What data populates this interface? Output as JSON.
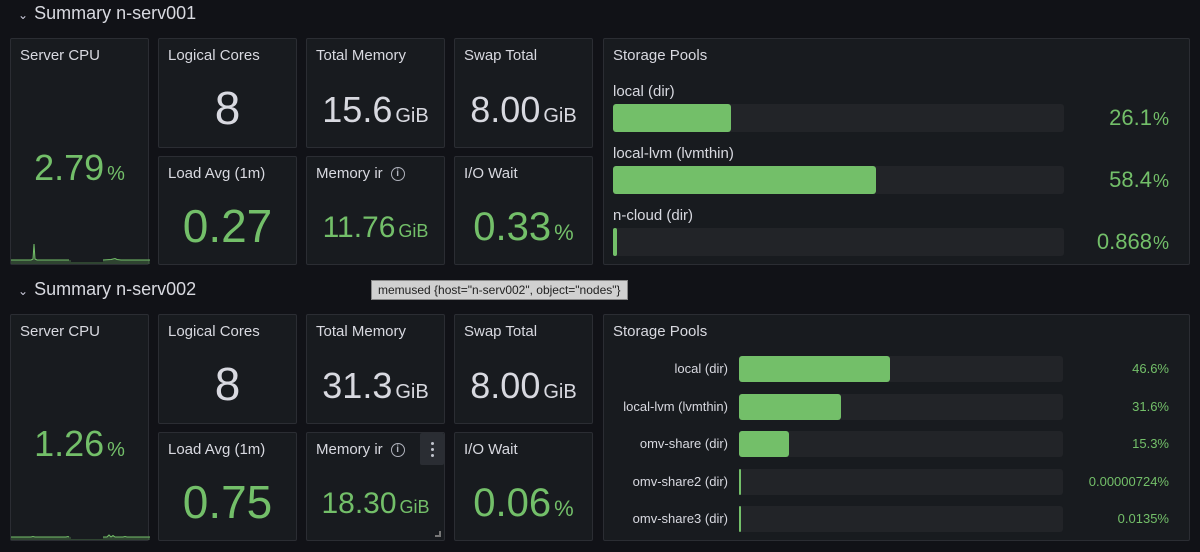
{
  "rows": [
    {
      "title": "Summary n-serv001",
      "server_cpu": {
        "title": "Server CPU",
        "value": "2.79",
        "unit": "%"
      },
      "logical_cores": {
        "title": "Logical Cores",
        "value": "8"
      },
      "total_memory": {
        "title": "Total Memory",
        "value": "15.6",
        "unit": "GiB"
      },
      "swap_total": {
        "title": "Swap Total",
        "value": "8.00",
        "unit": "GiB"
      },
      "load_avg": {
        "title": "Load Avg (1m)",
        "value": "0.27"
      },
      "memory_in_use": {
        "title": "Memory ir",
        "value": "11.76",
        "unit": "GiB"
      },
      "io_wait": {
        "title": "I/O Wait",
        "value": "0.33",
        "unit": "%"
      },
      "storage_pools": {
        "title": "Storage Pools",
        "items": [
          {
            "name": "local (dir)",
            "value": "26.1",
            "unit": "%",
            "percent": 26.1
          },
          {
            "name": "local-lvm (lvmthin)",
            "value": "58.4",
            "unit": "%",
            "percent": 58.4
          },
          {
            "name": "n-cloud (dir)",
            "value": "0.868",
            "unit": "%",
            "percent": 0.868
          }
        ]
      }
    },
    {
      "title": "Summary n-serv002",
      "server_cpu": {
        "title": "Server CPU",
        "value": "1.26",
        "unit": "%"
      },
      "logical_cores": {
        "title": "Logical Cores",
        "value": "8"
      },
      "total_memory": {
        "title": "Total Memory",
        "value": "31.3",
        "unit": "GiB"
      },
      "swap_total": {
        "title": "Swap Total",
        "value": "8.00",
        "unit": "GiB"
      },
      "load_avg": {
        "title": "Load Avg (1m)",
        "value": "0.75"
      },
      "memory_in_use": {
        "title": "Memory ir",
        "value": "18.30",
        "unit": "GiB"
      },
      "io_wait": {
        "title": "I/O Wait",
        "value": "0.06",
        "unit": "%"
      },
      "storage_pools": {
        "title": "Storage Pools",
        "items": [
          {
            "name": "local (dir)",
            "value": "46.6%",
            "percent": 46.6
          },
          {
            "name": "local-lvm (lvmthin)",
            "value": "31.6%",
            "percent": 31.6
          },
          {
            "name": "omv-share (dir)",
            "value": "15.3%",
            "percent": 15.3
          },
          {
            "name": "omv-share2 (dir)",
            "value": "0.00000724%",
            "percent": 7.24e-06
          },
          {
            "name": "omv-share3 (dir)",
            "value": "0.0135%",
            "percent": 0.0135
          }
        ]
      }
    }
  ],
  "tooltip": "memused {host=\"n-serv002\", object=\"nodes\"}",
  "colors": {
    "ok_green": "#73bf69",
    "panel_bg": "#181b1f",
    "page_bg": "#111217"
  }
}
